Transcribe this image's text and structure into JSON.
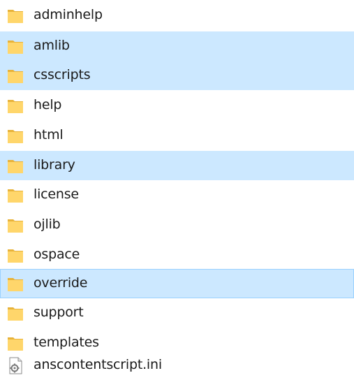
{
  "window": {
    "title": ""
  },
  "file_list": {
    "items": [
      {
        "name": "adminhelp",
        "type": "folder",
        "icon": "folder-icon",
        "selected": false,
        "focused": false
      },
      {
        "name": "amlib",
        "type": "folder",
        "icon": "folder-icon",
        "selected": true,
        "focused": false
      },
      {
        "name": "csscripts",
        "type": "folder",
        "icon": "folder-icon",
        "selected": true,
        "focused": false
      },
      {
        "name": "help",
        "type": "folder",
        "icon": "folder-icon",
        "selected": false,
        "focused": false
      },
      {
        "name": "html",
        "type": "folder",
        "icon": "folder-icon",
        "selected": false,
        "focused": false
      },
      {
        "name": "library",
        "type": "folder",
        "icon": "folder-icon",
        "selected": true,
        "focused": false
      },
      {
        "name": "license",
        "type": "folder",
        "icon": "folder-icon",
        "selected": false,
        "focused": false
      },
      {
        "name": "ojlib",
        "type": "folder",
        "icon": "folder-icon",
        "selected": false,
        "focused": false
      },
      {
        "name": "ospace",
        "type": "folder",
        "icon": "folder-icon",
        "selected": false,
        "focused": false
      },
      {
        "name": "override",
        "type": "folder",
        "icon": "folder-icon",
        "selected": true,
        "focused": true
      },
      {
        "name": "support",
        "type": "folder",
        "icon": "folder-icon",
        "selected": false,
        "focused": false
      },
      {
        "name": "templates",
        "type": "folder",
        "icon": "folder-icon",
        "selected": false,
        "focused": false
      },
      {
        "name": "anscontentscript.ini",
        "type": "file",
        "icon": "settings-file-icon",
        "selected": false,
        "focused": false
      }
    ]
  },
  "colors": {
    "selection_bg": "#cce8ff",
    "focus_border": "#99d1ff",
    "folder_front": "#ffd66b",
    "folder_back": "#e8b33a"
  }
}
